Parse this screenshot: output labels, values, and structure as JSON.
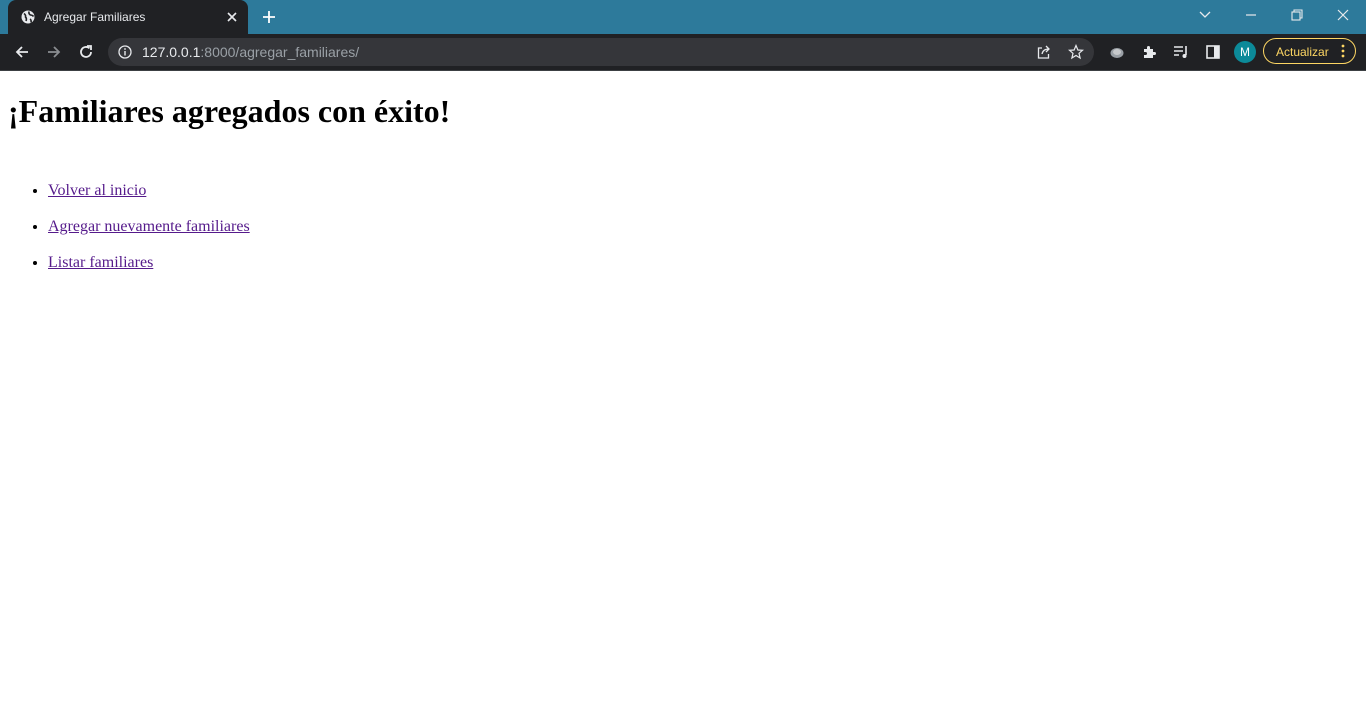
{
  "browser": {
    "tab": {
      "title": "Agregar Familiares",
      "favicon": "globe-icon"
    },
    "new_tab_icon": "plus-icon",
    "window_controls": [
      "tab-search-icon",
      "minimize-icon",
      "restore-icon",
      "close-icon"
    ],
    "address": {
      "host": "127.0.0.1",
      "rest": ":8000/agregar_familiares/"
    },
    "update_label": "Actualizar",
    "avatar_initial": "M",
    "colors": {
      "tabstrip": "#2d7a9b",
      "toolbar": "#202124",
      "update_accent": "#fdd663",
      "avatar": "#0c8a99"
    }
  },
  "page": {
    "heading": "¡Familiares agregados con éxito!",
    "links": [
      {
        "label": "Volver al inicio"
      },
      {
        "label": "Agregar nuevamente familiares"
      },
      {
        "label": "Listar familiares"
      }
    ],
    "colors": {
      "link_visited": "#551a8b"
    }
  }
}
